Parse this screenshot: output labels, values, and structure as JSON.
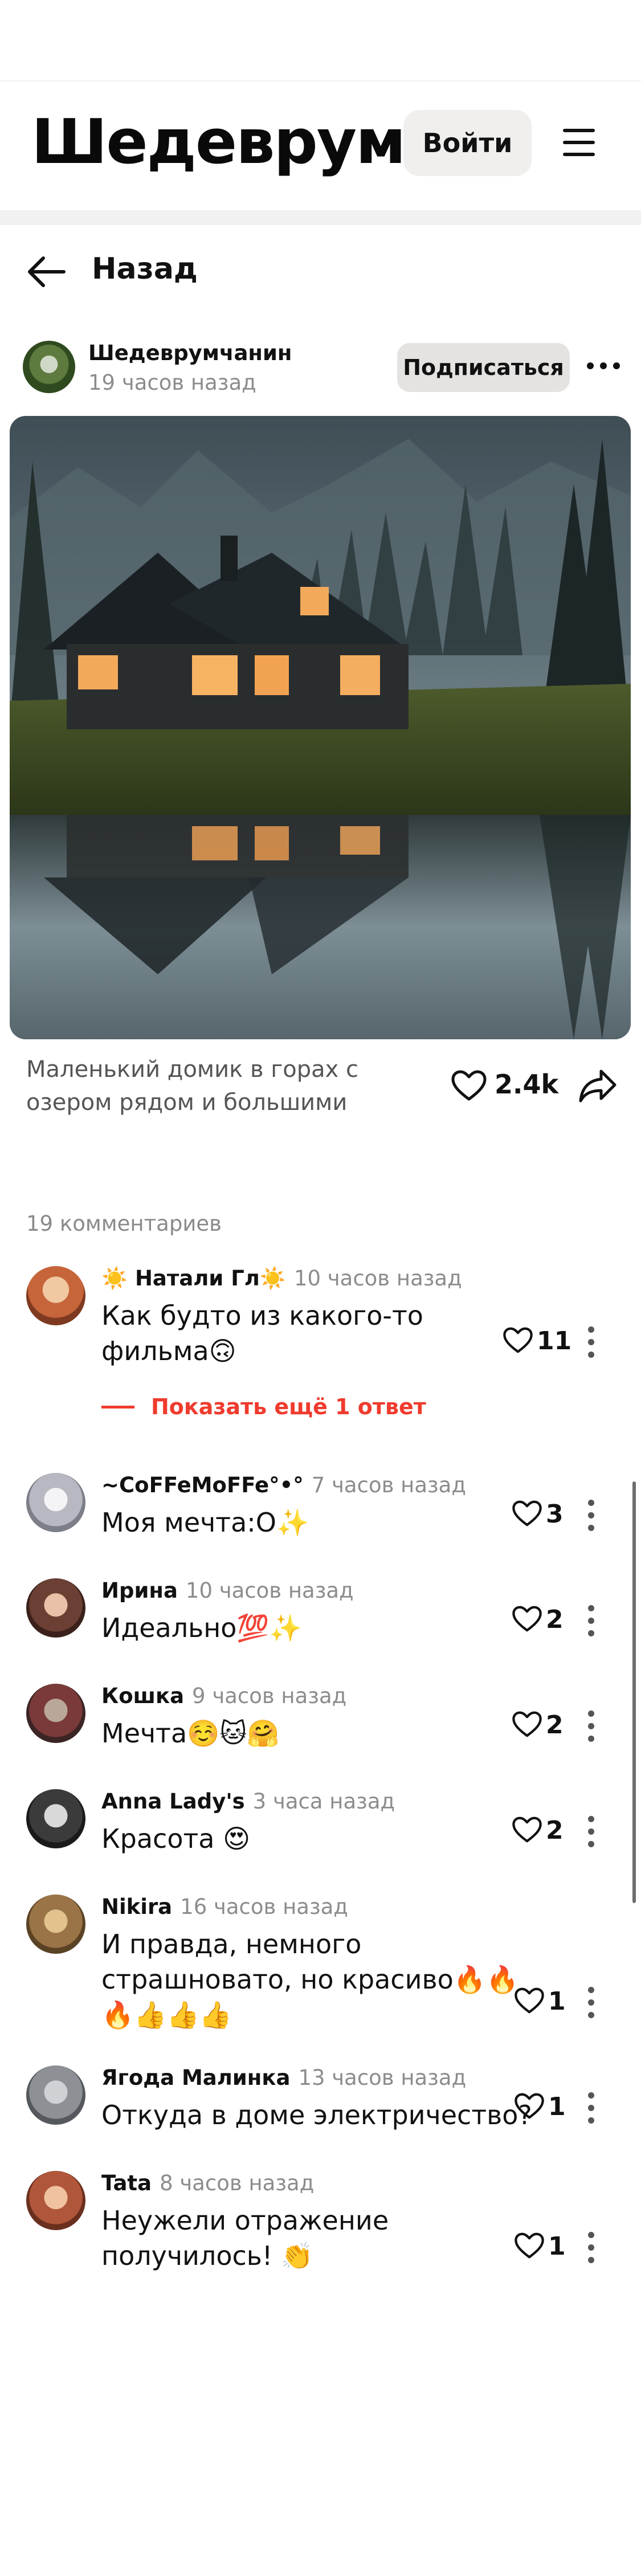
{
  "header": {
    "logo": "Шедеврум",
    "login_label": "Войти",
    "menu_icon": "hamburger-icon"
  },
  "nav": {
    "back_label": "Назад",
    "back_icon": "arrow-left-icon"
  },
  "post": {
    "author_name": "Шедеврумчанин",
    "author_time": "19 часов назад",
    "subscribe_label": "Подписаться",
    "caption_line1": "Маленький домик в горах с",
    "caption_line2": "озером рядом и большими",
    "likes": "2.4k",
    "like_icon": "heart-icon",
    "share_icon": "share-icon"
  },
  "comments_header": "19 комментариев",
  "comments": [
    {
      "name": "☀️ Натали Гл☀️",
      "time": "10 часов назад",
      "line1": "Как будто из какого-то",
      "line2": "фильма🙃",
      "likes": "11",
      "avatar": "#c6653a"
    },
    {
      "name": "~CoFFeMoFFe°•°",
      "time": "7 часов назад",
      "line1": "Моя мечта:О✨",
      "line2": "",
      "likes": "3",
      "avatar": "#b7b8c2"
    },
    {
      "name": "Ирина",
      "time": "10 часов назад",
      "line1": "Идеально💯✨",
      "line2": "",
      "likes": "2",
      "avatar": "#6b3f33"
    },
    {
      "name": "Кошка",
      "time": "9 часов назад",
      "line1": "Мечта☺️🐱🤗",
      "line2": "",
      "likes": "2",
      "avatar": "#7a3a3a"
    },
    {
      "name": "Anna Lady's",
      "time": "3 часа назад",
      "line1": "Красота 😍",
      "line2": "",
      "likes": "2",
      "avatar": "#3b3b3b"
    },
    {
      "name": "Nikira",
      "time": "16 часов назад",
      "line1": "И правда, немного",
      "line2": "страшновато, но красиво🔥🔥",
      "line3": "🔥👍👍👍",
      "likes": "1",
      "avatar": "#9a7446"
    },
    {
      "name": "Ягода Малинка",
      "time": "13 часов назад",
      "line1": "Откуда в доме электричество?",
      "line2": "",
      "likes": "1",
      "avatar": "#8d9094"
    },
    {
      "name": "Tata",
      "time": "8 часов назад",
      "line1": "Неужели отражение",
      "line2": "получилось! 👏",
      "likes": "1",
      "avatar": "#b0563a"
    }
  ],
  "show_more_label": "Показать ещё 1 ответ",
  "colors": {
    "accent_red": "#ef3b2d",
    "button_bg": "#f0efed",
    "muted_text": "#8c8c8c"
  }
}
